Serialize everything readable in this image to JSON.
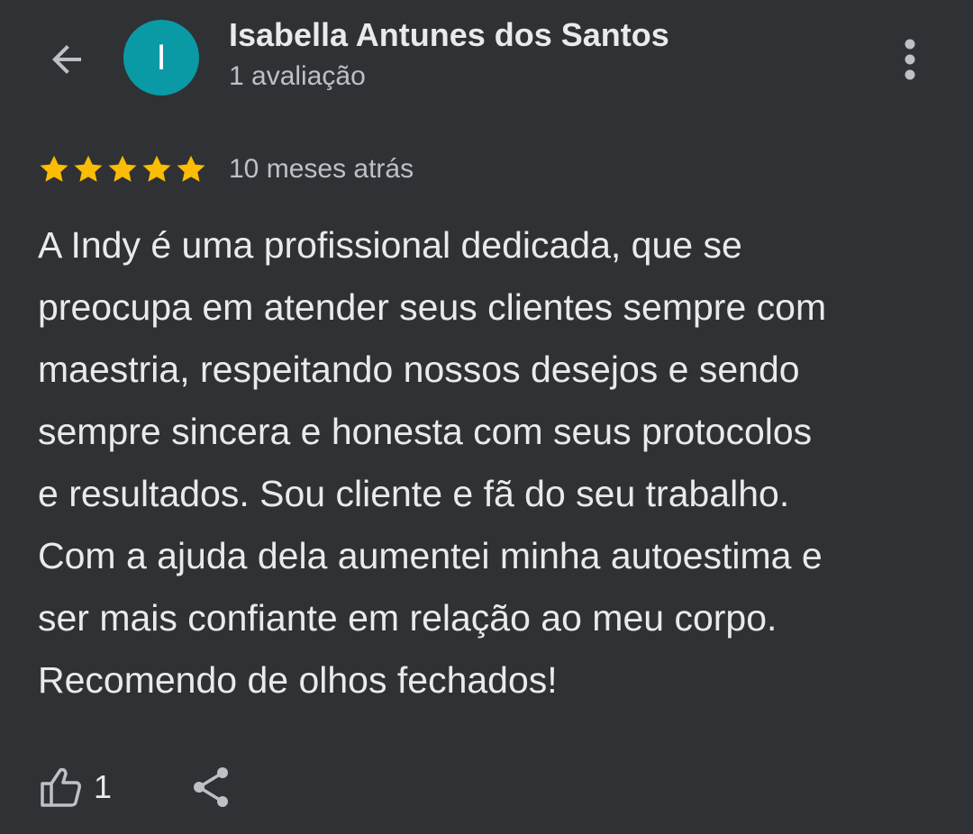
{
  "header": {
    "back_icon": "arrow-left-icon",
    "reviewer_name": "Isabella Antunes dos Santos",
    "reviewer_initial": "I",
    "reviewer_review_count": "1 avaliação",
    "avatar_color": "#0a9aa6",
    "more_icon": "more-vert-icon"
  },
  "review": {
    "rating": 5,
    "rating_max": 5,
    "star_color": "#fbbc04",
    "date": "10 meses atrás",
    "text_lines": [
      "A Indy é uma profissional dedicada, que se",
      "preocupa em atender seus clientes sempre com",
      "maestria, respeitando nossos desejos e sendo",
      "sempre sincera e honesta com seus protocolos",
      "e resultados. Sou cliente e fã do seu trabalho.",
      "Com a ajuda dela aumentei minha autoestima e",
      "ser mais confiante em relação ao meu corpo.",
      "Recomendo de olhos fechados!"
    ]
  },
  "actions": {
    "like_icon": "thumb-up-icon",
    "like_count": "1",
    "share_icon": "share-icon"
  },
  "theme": {
    "background": "#303134",
    "text_primary": "#e8eaed",
    "text_secondary": "#bdc1c6"
  }
}
